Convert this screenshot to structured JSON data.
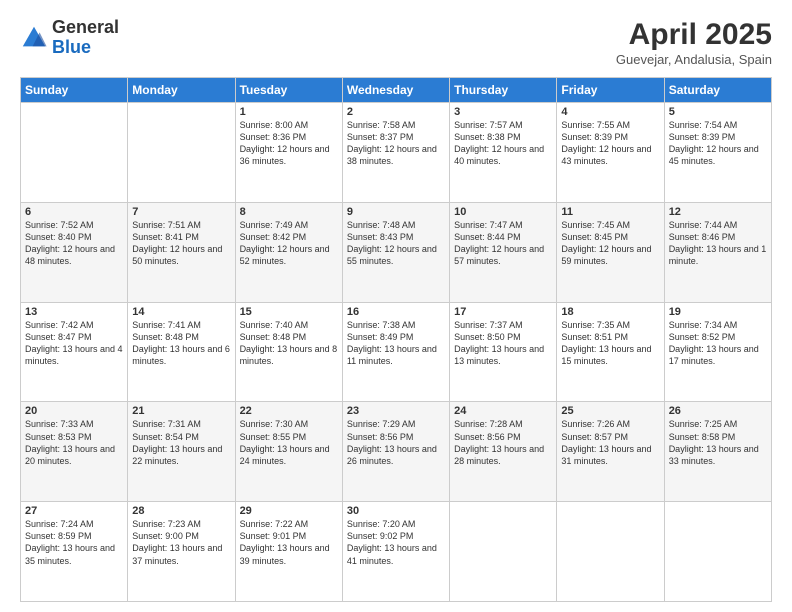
{
  "header": {
    "logo_general": "General",
    "logo_blue": "Blue",
    "month_title": "April 2025",
    "subtitle": "Guevejar, Andalusia, Spain"
  },
  "days_of_week": [
    "Sunday",
    "Monday",
    "Tuesday",
    "Wednesday",
    "Thursday",
    "Friday",
    "Saturday"
  ],
  "weeks": [
    [
      {
        "day": "",
        "sunrise": "",
        "sunset": "",
        "daylight": ""
      },
      {
        "day": "",
        "sunrise": "",
        "sunset": "",
        "daylight": ""
      },
      {
        "day": "1",
        "sunrise": "Sunrise: 8:00 AM",
        "sunset": "Sunset: 8:36 PM",
        "daylight": "Daylight: 12 hours and 36 minutes."
      },
      {
        "day": "2",
        "sunrise": "Sunrise: 7:58 AM",
        "sunset": "Sunset: 8:37 PM",
        "daylight": "Daylight: 12 hours and 38 minutes."
      },
      {
        "day": "3",
        "sunrise": "Sunrise: 7:57 AM",
        "sunset": "Sunset: 8:38 PM",
        "daylight": "Daylight: 12 hours and 40 minutes."
      },
      {
        "day": "4",
        "sunrise": "Sunrise: 7:55 AM",
        "sunset": "Sunset: 8:39 PM",
        "daylight": "Daylight: 12 hours and 43 minutes."
      },
      {
        "day": "5",
        "sunrise": "Sunrise: 7:54 AM",
        "sunset": "Sunset: 8:39 PM",
        "daylight": "Daylight: 12 hours and 45 minutes."
      }
    ],
    [
      {
        "day": "6",
        "sunrise": "Sunrise: 7:52 AM",
        "sunset": "Sunset: 8:40 PM",
        "daylight": "Daylight: 12 hours and 48 minutes."
      },
      {
        "day": "7",
        "sunrise": "Sunrise: 7:51 AM",
        "sunset": "Sunset: 8:41 PM",
        "daylight": "Daylight: 12 hours and 50 minutes."
      },
      {
        "day": "8",
        "sunrise": "Sunrise: 7:49 AM",
        "sunset": "Sunset: 8:42 PM",
        "daylight": "Daylight: 12 hours and 52 minutes."
      },
      {
        "day": "9",
        "sunrise": "Sunrise: 7:48 AM",
        "sunset": "Sunset: 8:43 PM",
        "daylight": "Daylight: 12 hours and 55 minutes."
      },
      {
        "day": "10",
        "sunrise": "Sunrise: 7:47 AM",
        "sunset": "Sunset: 8:44 PM",
        "daylight": "Daylight: 12 hours and 57 minutes."
      },
      {
        "day": "11",
        "sunrise": "Sunrise: 7:45 AM",
        "sunset": "Sunset: 8:45 PM",
        "daylight": "Daylight: 12 hours and 59 minutes."
      },
      {
        "day": "12",
        "sunrise": "Sunrise: 7:44 AM",
        "sunset": "Sunset: 8:46 PM",
        "daylight": "Daylight: 13 hours and 1 minute."
      }
    ],
    [
      {
        "day": "13",
        "sunrise": "Sunrise: 7:42 AM",
        "sunset": "Sunset: 8:47 PM",
        "daylight": "Daylight: 13 hours and 4 minutes."
      },
      {
        "day": "14",
        "sunrise": "Sunrise: 7:41 AM",
        "sunset": "Sunset: 8:48 PM",
        "daylight": "Daylight: 13 hours and 6 minutes."
      },
      {
        "day": "15",
        "sunrise": "Sunrise: 7:40 AM",
        "sunset": "Sunset: 8:48 PM",
        "daylight": "Daylight: 13 hours and 8 minutes."
      },
      {
        "day": "16",
        "sunrise": "Sunrise: 7:38 AM",
        "sunset": "Sunset: 8:49 PM",
        "daylight": "Daylight: 13 hours and 11 minutes."
      },
      {
        "day": "17",
        "sunrise": "Sunrise: 7:37 AM",
        "sunset": "Sunset: 8:50 PM",
        "daylight": "Daylight: 13 hours and 13 minutes."
      },
      {
        "day": "18",
        "sunrise": "Sunrise: 7:35 AM",
        "sunset": "Sunset: 8:51 PM",
        "daylight": "Daylight: 13 hours and 15 minutes."
      },
      {
        "day": "19",
        "sunrise": "Sunrise: 7:34 AM",
        "sunset": "Sunset: 8:52 PM",
        "daylight": "Daylight: 13 hours and 17 minutes."
      }
    ],
    [
      {
        "day": "20",
        "sunrise": "Sunrise: 7:33 AM",
        "sunset": "Sunset: 8:53 PM",
        "daylight": "Daylight: 13 hours and 20 minutes."
      },
      {
        "day": "21",
        "sunrise": "Sunrise: 7:31 AM",
        "sunset": "Sunset: 8:54 PM",
        "daylight": "Daylight: 13 hours and 22 minutes."
      },
      {
        "day": "22",
        "sunrise": "Sunrise: 7:30 AM",
        "sunset": "Sunset: 8:55 PM",
        "daylight": "Daylight: 13 hours and 24 minutes."
      },
      {
        "day": "23",
        "sunrise": "Sunrise: 7:29 AM",
        "sunset": "Sunset: 8:56 PM",
        "daylight": "Daylight: 13 hours and 26 minutes."
      },
      {
        "day": "24",
        "sunrise": "Sunrise: 7:28 AM",
        "sunset": "Sunset: 8:56 PM",
        "daylight": "Daylight: 13 hours and 28 minutes."
      },
      {
        "day": "25",
        "sunrise": "Sunrise: 7:26 AM",
        "sunset": "Sunset: 8:57 PM",
        "daylight": "Daylight: 13 hours and 31 minutes."
      },
      {
        "day": "26",
        "sunrise": "Sunrise: 7:25 AM",
        "sunset": "Sunset: 8:58 PM",
        "daylight": "Daylight: 13 hours and 33 minutes."
      }
    ],
    [
      {
        "day": "27",
        "sunrise": "Sunrise: 7:24 AM",
        "sunset": "Sunset: 8:59 PM",
        "daylight": "Daylight: 13 hours and 35 minutes."
      },
      {
        "day": "28",
        "sunrise": "Sunrise: 7:23 AM",
        "sunset": "Sunset: 9:00 PM",
        "daylight": "Daylight: 13 hours and 37 minutes."
      },
      {
        "day": "29",
        "sunrise": "Sunrise: 7:22 AM",
        "sunset": "Sunset: 9:01 PM",
        "daylight": "Daylight: 13 hours and 39 minutes."
      },
      {
        "day": "30",
        "sunrise": "Sunrise: 7:20 AM",
        "sunset": "Sunset: 9:02 PM",
        "daylight": "Daylight: 13 hours and 41 minutes."
      },
      {
        "day": "",
        "sunrise": "",
        "sunset": "",
        "daylight": ""
      },
      {
        "day": "",
        "sunrise": "",
        "sunset": "",
        "daylight": ""
      },
      {
        "day": "",
        "sunrise": "",
        "sunset": "",
        "daylight": ""
      }
    ]
  ]
}
